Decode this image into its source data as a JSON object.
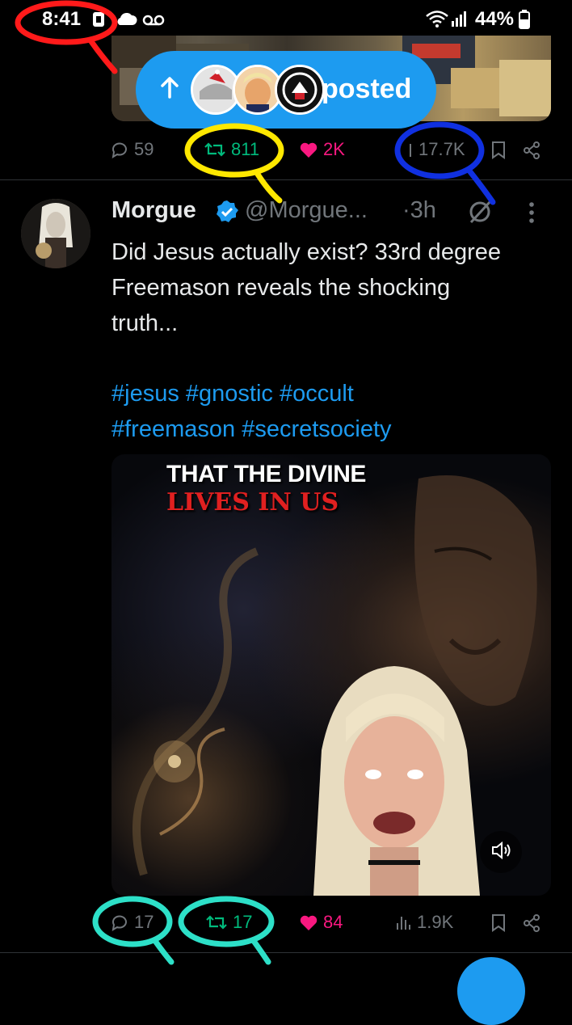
{
  "status_bar": {
    "time": "8:41",
    "battery": "44%"
  },
  "posted_pill": {
    "label": "posted"
  },
  "prev_tweet": {
    "replies": "59",
    "reposts": "811",
    "likes": "2K",
    "views": "17.7K"
  },
  "tweet": {
    "author": "Morgue",
    "handle": "@Morgue...",
    "time_ago": "·3h",
    "text_lines": [
      "Did Jesus actually exist? 33rd degree",
      "Freemason reveals the shocking",
      "truth..."
    ],
    "hashtags_lines": [
      "#jesus #gnostic #occult",
      "#freemason #secretsociety"
    ],
    "video_caption_1": "THAT THE DIVINE",
    "video_caption_2": "LIVES IN US",
    "replies": "17",
    "reposts": "17",
    "likes": "84",
    "views": "1.9K"
  },
  "colors": {
    "accent": "#1d9bf0",
    "repost_green": "#00ba7c",
    "like_pink": "#f91880",
    "annot_red": "#ff1a1a",
    "annot_yellow": "#ffe800",
    "annot_blue": "#1030e0",
    "annot_teal": "#2de0c8"
  },
  "icons": [
    "reply-icon",
    "repost-icon",
    "heart-icon",
    "views-icon",
    "bookmark-icon",
    "share-icon",
    "verified-icon",
    "grok-icon",
    "more-icon",
    "speaker-icon",
    "wifi-icon",
    "signal-icon",
    "battery-icon",
    "cloud-icon",
    "voicemail-icon"
  ]
}
